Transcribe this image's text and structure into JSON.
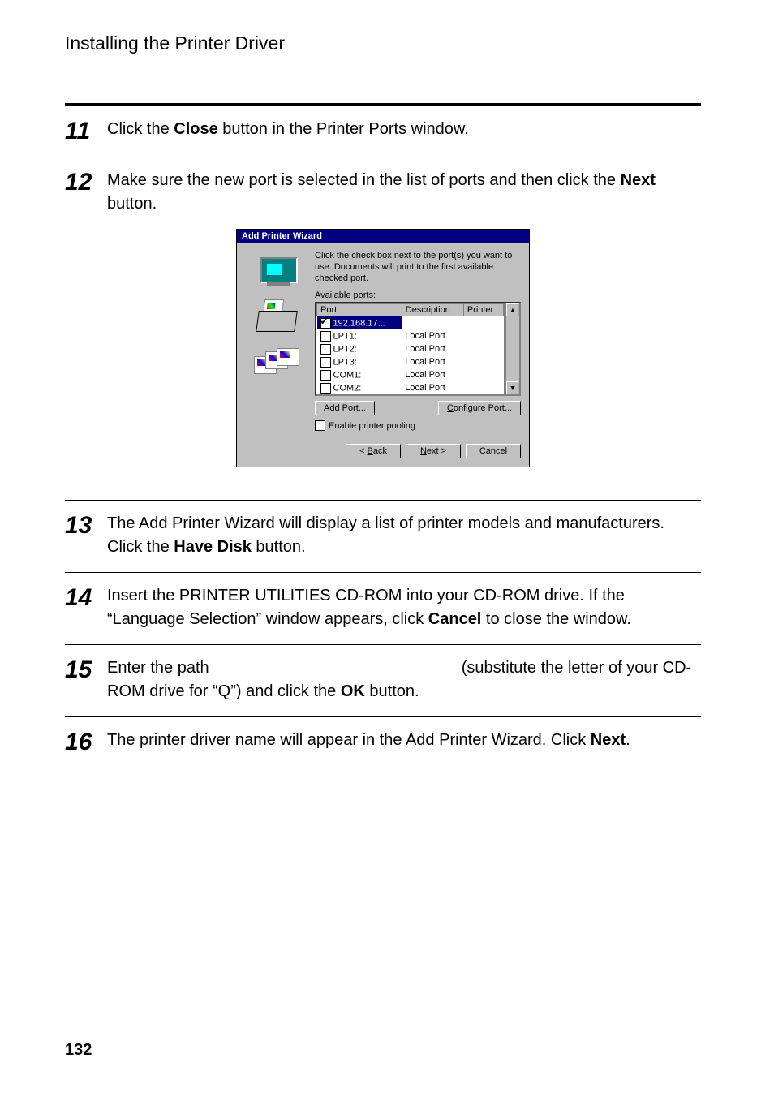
{
  "header": "Installing the Printer Driver",
  "page_number": "132",
  "steps": {
    "s11": {
      "num": "11",
      "pre": "Click the ",
      "b1": "Close",
      "post": " button in the Printer Ports window."
    },
    "s12": {
      "num": "12",
      "pre": "Make sure the new port is selected in the list of ports and then click the ",
      "b1": "Next",
      "post": " button."
    },
    "s13": {
      "num": "13",
      "pre": "The Add Printer Wizard will display a list of printer models and manufacturers. Click the ",
      "b1": "Have Disk",
      "post": " button."
    },
    "s14": {
      "num": "14",
      "pre": "Insert the PRINTER UTILITIES CD-ROM into your CD-ROM drive. If the “Language Selection” window appears, click ",
      "b1": "Cancel",
      "post": " to close the window."
    },
    "s15": {
      "num": "15",
      "pre": "Enter the path ",
      "mid": " (substitute the letter of your CD-ROM drive for “Q”) and click the ",
      "b1": "OK",
      "post": " button."
    },
    "s16": {
      "num": "16",
      "pre": "The printer driver name will appear in the Add Printer Wizard. Click ",
      "b1": "Next",
      "post": "."
    }
  },
  "dialog": {
    "title": "Add Printer Wizard",
    "instruction": "Click the check box next to the port(s) you want to use. Documents will print to the first available checked port.",
    "available_label_pre": "A",
    "available_label_post": "vailable ports:",
    "columns": {
      "port": "Port",
      "desc": "Description",
      "printer": "Printer"
    },
    "rows": [
      {
        "checked": true,
        "port": "192.168.17...",
        "desc": "",
        "printer": "",
        "selected": true
      },
      {
        "checked": false,
        "port": "LPT1:",
        "desc": "Local Port",
        "printer": ""
      },
      {
        "checked": false,
        "port": "LPT2:",
        "desc": "Local Port",
        "printer": ""
      },
      {
        "checked": false,
        "port": "LPT3:",
        "desc": "Local Port",
        "printer": ""
      },
      {
        "checked": false,
        "port": "COM1:",
        "desc": "Local Port",
        "printer": ""
      },
      {
        "checked": false,
        "port": "COM2:",
        "desc": "Local Port",
        "printer": ""
      }
    ],
    "add_port_btn": "Add Port...",
    "configure_port_btn": "Configure Port...",
    "enable_pooling_pre": "E",
    "enable_pooling_post": "nable printer pooling",
    "back_btn": "< Back",
    "next_btn": "Next >",
    "cancel_btn": "Cancel",
    "back_ul": "B",
    "next_ul": "N"
  }
}
